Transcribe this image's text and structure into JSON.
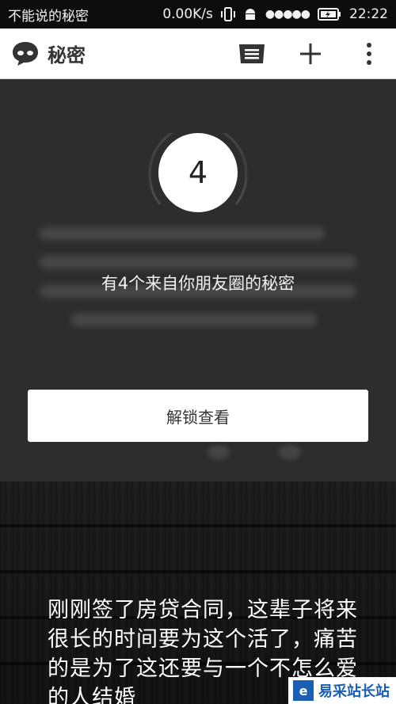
{
  "status_bar": {
    "app_name": "不能说的秘密",
    "network_speed": "0.00K/s",
    "signal": "●●●●●",
    "time": "22:22"
  },
  "app_bar": {
    "title": "秘密",
    "icons": [
      "chat-bubble-logo-icon",
      "inbox-icon",
      "plus-icon",
      "overflow-menu-icon"
    ]
  },
  "lock_panel": {
    "count": "4",
    "message": "有4个来自你朋友圈的秘密",
    "unlock_label": "解锁查看"
  },
  "post": {
    "text": "刚刚签了房贷合同，这辈子将来很长的时间要为这个活了，痛苦的是为了这还要与一个不怎么爱的人结婚"
  },
  "watermark": {
    "label": "易采站长站"
  },
  "colors": {
    "panel_bg": "#2d2d2d",
    "app_bar_bg": "#ffffff",
    "status_bar_bg": "#0d0d0d",
    "watermark_blue": "#1a5fb4"
  }
}
